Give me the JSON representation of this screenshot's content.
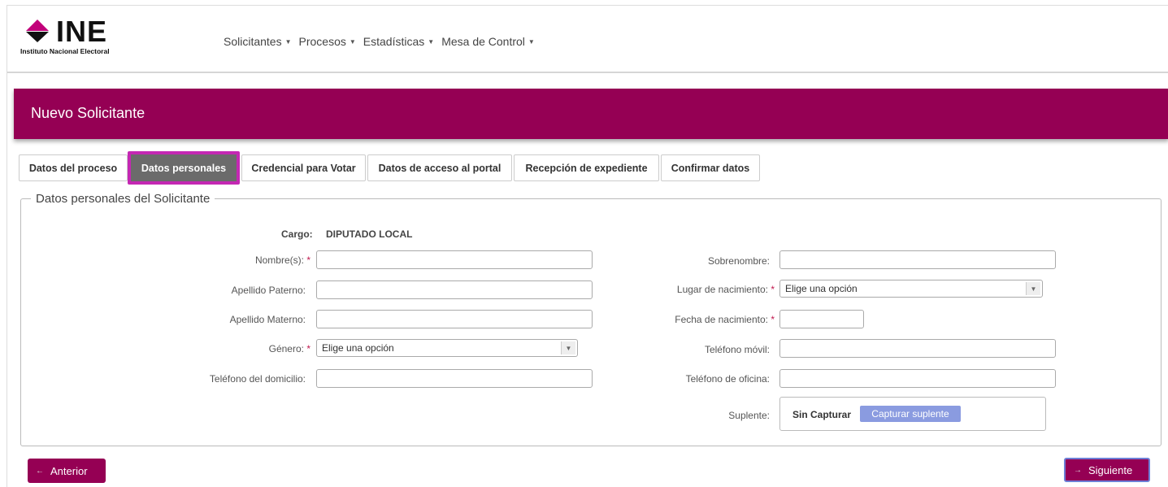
{
  "header": {
    "logo_text": "INE",
    "logo_subtitle": "Instituto Nacional Electoral",
    "nav": [
      {
        "label": "Solicitantes"
      },
      {
        "label": "Procesos"
      },
      {
        "label": "Estadísticas"
      },
      {
        "label": "Mesa de Control"
      }
    ]
  },
  "banner": {
    "title": "Nuevo Solicitante"
  },
  "tabs": [
    {
      "label": "Datos del proceso",
      "active": false
    },
    {
      "label": "Datos personales",
      "active": true
    },
    {
      "label": "Credencial para Votar",
      "active": false
    },
    {
      "label": "Datos de acceso al portal",
      "active": false
    },
    {
      "label": "Recepción de expediente",
      "active": false
    },
    {
      "label": "Confirmar datos",
      "active": false
    }
  ],
  "form": {
    "legend": "Datos personales del Solicitante",
    "cargo_label": "Cargo:",
    "cargo_value": "DIPUTADO LOCAL",
    "left": {
      "nombre_label": "Nombre(s):",
      "apellido_paterno_label": "Apellido Paterno:",
      "apellido_materno_label": "Apellido Materno:",
      "genero_label": "Género:",
      "genero_value": "Elige una opción",
      "telefono_domicilio_label": "Teléfono del domicilio:"
    },
    "right": {
      "sobrenombre_label": "Sobrenombre:",
      "lugar_nacimiento_label": "Lugar de nacimiento:",
      "lugar_nacimiento_value": "Elige una opción",
      "fecha_nacimiento_label": "Fecha de nacimiento:",
      "telefono_movil_label": "Teléfono móvil:",
      "telefono_oficina_label": "Teléfono de oficina:",
      "suplente_label": "Suplente:",
      "sin_capturar": "Sin Capturar",
      "capturar_suplente": "Capturar suplente"
    },
    "required_mark": "*"
  },
  "footer": {
    "anterior_label": "Anterior",
    "siguiente_label": "Siguiente"
  },
  "colors": {
    "brand": "#950054",
    "active_tab_border": "#c428b3",
    "secondary_button": "#8a9be0"
  }
}
